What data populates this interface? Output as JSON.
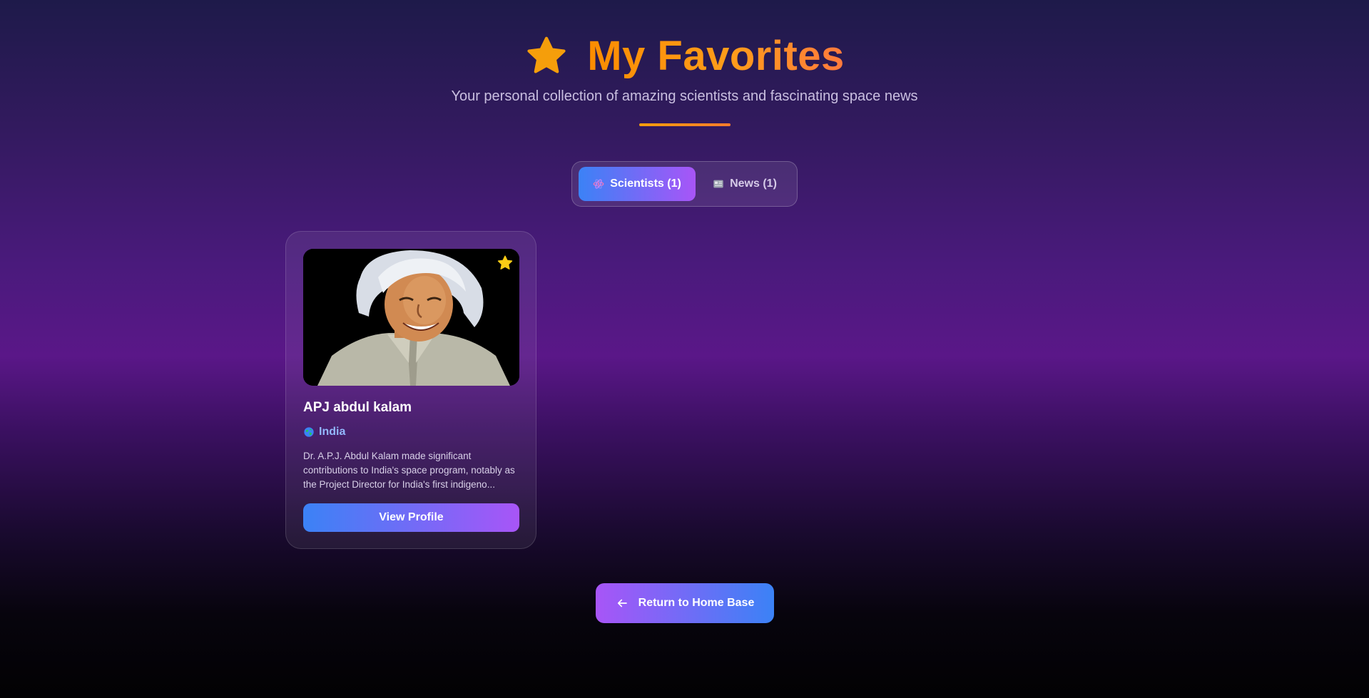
{
  "header": {
    "title": "My Favorites",
    "subtitle": "Your personal collection of amazing scientists and fascinating space news",
    "icon": "star-icon"
  },
  "tabs": [
    {
      "label": "Scientists (1)",
      "icon": "atom-icon",
      "active": true
    },
    {
      "label": "News (1)",
      "icon": "newspaper-icon",
      "active": false
    }
  ],
  "favorites": {
    "scientists": [
      {
        "name": "APJ abdul kalam",
        "country": "India",
        "country_icon": "globe-icon",
        "description": "Dr. A.P.J. Abdul Kalam made significant contributions to India's space program, notably as the Project Director for India's first indigeno...",
        "favorite_icon": "star-icon",
        "button_label": "View Profile"
      }
    ]
  },
  "footer": {
    "return_label": "Return to Home Base",
    "return_icon": "arrow-left-icon"
  },
  "colors": {
    "accent_orange": "#fb8c00",
    "accent_blue": "#3b82f6",
    "accent_purple": "#a855f7",
    "star_gold": "#facc15"
  }
}
